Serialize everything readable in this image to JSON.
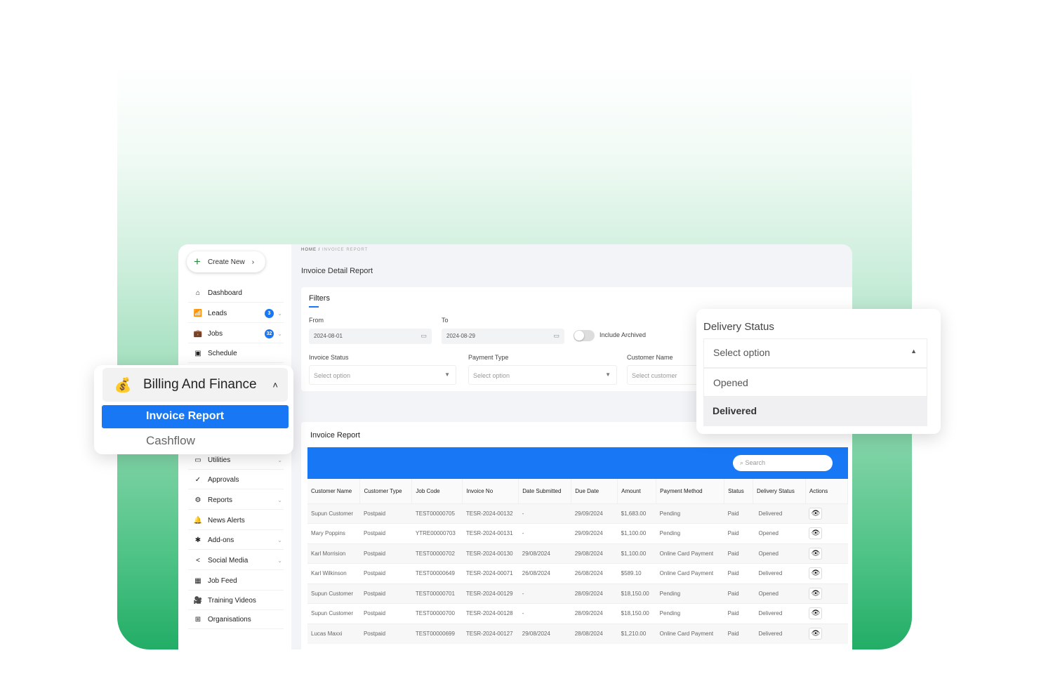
{
  "sidebar": {
    "create_new": "Create New",
    "items": [
      {
        "label": "Dashboard",
        "icon": "home-icon",
        "glyph": "⌂"
      },
      {
        "label": "Leads",
        "icon": "chart-icon",
        "glyph": "📶",
        "badge": "3",
        "chev": true
      },
      {
        "label": "Jobs",
        "icon": "briefcase-icon",
        "glyph": "💼",
        "badge": "32",
        "chev": true
      },
      {
        "label": "Schedule",
        "icon": "calendar-icon",
        "glyph": "▣"
      },
      {
        "label": "Utilities",
        "icon": "utilities-icon",
        "glyph": "▭",
        "chev": true
      },
      {
        "label": "Approvals",
        "icon": "approval-icon",
        "glyph": "✓"
      },
      {
        "label": "Reports",
        "icon": "gear-icon",
        "glyph": "⚙",
        "chev": true
      },
      {
        "label": "News Alerts",
        "icon": "bell-icon",
        "glyph": "🔔"
      },
      {
        "label": "Add-ons",
        "icon": "puzzle-icon",
        "glyph": "✱",
        "chev": true
      },
      {
        "label": "Social Media",
        "icon": "share-icon",
        "glyph": "<",
        "chev": true
      },
      {
        "label": "Job Feed",
        "icon": "rss-icon",
        "glyph": "▦"
      },
      {
        "label": "Training Videos",
        "icon": "video-icon",
        "glyph": "🎥"
      },
      {
        "label": "Organisations",
        "icon": "building-icon",
        "glyph": "⊞"
      }
    ]
  },
  "billing": {
    "title": "Billing And Finance",
    "active": "Invoice Report",
    "other": "Cashflow"
  },
  "breadcrumb": {
    "home": "HOME",
    "sep": "/",
    "current": "INVOICE REPORT"
  },
  "page_title": "Invoice Detail Report",
  "filters": {
    "title": "Filters",
    "from_label": "From",
    "from_value": "2024-08-01",
    "to_label": "To",
    "to_value": "2024-08-29",
    "include_archived": "Include Archived",
    "invoice_status_label": "Invoice Status",
    "invoice_status_placeholder": "Select option",
    "payment_type_label": "Payment Type",
    "payment_type_placeholder": "Select option",
    "customer_name_label": "Customer Name",
    "customer_name_placeholder": "Select customer"
  },
  "delivery_popup": {
    "title": "Delivery Status",
    "placeholder": "Select option",
    "options": [
      "Opened",
      "Delivered"
    ],
    "highlighted": "Delivered"
  },
  "report": {
    "title": "Invoice Report",
    "search_placeholder": "Search",
    "accent": "#1777f5",
    "columns": [
      "Customer Name",
      "Customer Type",
      "Job Code",
      "Invoice No",
      "Date Submitted",
      "Due Date",
      "Amount",
      "Payment Method",
      "Status",
      "Delivery Status",
      "Actions"
    ],
    "rows": [
      [
        "Supun Customer",
        "Postpaid",
        "TEST00000705",
        "TESR-2024-00132",
        "-",
        "29/09/2024",
        "$1,683.00",
        "Pending",
        "Paid",
        "Delivered"
      ],
      [
        "Mary Poppins",
        "Postpaid",
        "YTRE00000703",
        "TESR-2024-00131",
        "-",
        "29/09/2024",
        "$1,100.00",
        "Pending",
        "Paid",
        "Opened"
      ],
      [
        "Karl Morrision",
        "Postpaid",
        "TEST00000702",
        "TESR-2024-00130",
        "29/08/2024",
        "29/08/2024",
        "$1,100.00",
        "Online Card Payment",
        "Paid",
        "Opened"
      ],
      [
        "Karl Wilkinson",
        "Postpaid",
        "TEST00000649",
        "TESR-2024-00071",
        "26/08/2024",
        "26/08/2024",
        "$589.10",
        "Online Card Payment",
        "Paid",
        "Delivered"
      ],
      [
        "Supun Customer",
        "Postpaid",
        "TEST00000701",
        "TESR-2024-00129",
        "-",
        "28/09/2024",
        "$18,150.00",
        "Pending",
        "Paid",
        "Opened"
      ],
      [
        "Supun Customer",
        "Postpaid",
        "TEST00000700",
        "TESR-2024-00128",
        "-",
        "28/09/2024",
        "$18,150.00",
        "Pending",
        "Paid",
        "Delivered"
      ],
      [
        "Lucas Maxxi",
        "Postpaid",
        "TEST00000699",
        "TESR-2024-00127",
        "29/08/2024",
        "28/08/2024",
        "$1,210.00",
        "Online Card Payment",
        "Paid",
        "Delivered"
      ]
    ]
  }
}
